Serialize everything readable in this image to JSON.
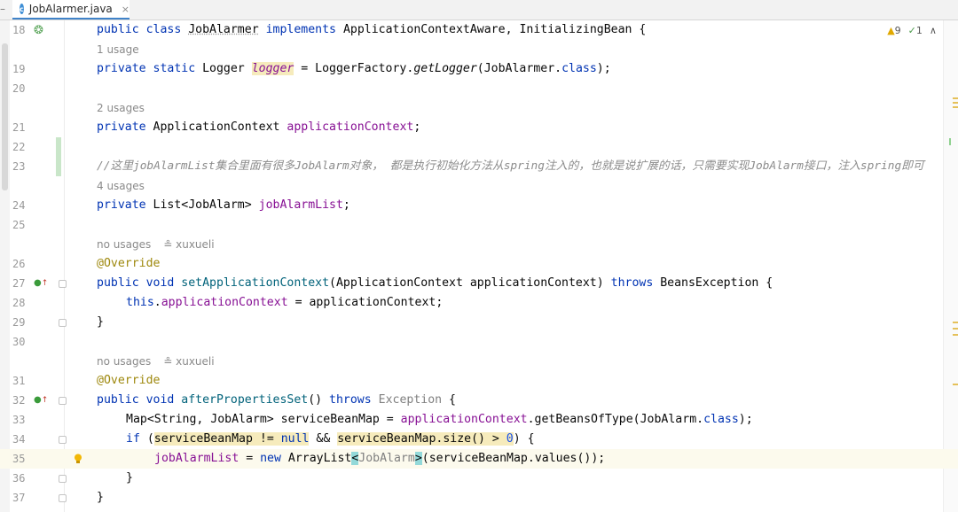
{
  "tab": {
    "file_name": "JobAlarmer.java",
    "icon": "java-class-icon",
    "close": "×"
  },
  "inspections": {
    "warnings": "9",
    "ok": "1",
    "up": "∧",
    "down": "∨"
  },
  "code": {
    "l18": {
      "num": "18",
      "kw1": "public class",
      "name": "JobAlarmer",
      "kw2": "implements",
      "rest": "ApplicationContextAware, InitializingBean {"
    },
    "l19_usage": "1 usage",
    "l19": {
      "num": "19",
      "kw": "private static",
      "type": "Logger",
      "field": "logger",
      "eq": " = LoggerFactory.",
      "method": "getLogger",
      "args1": "(JobAlarmer.",
      "cls": "class",
      "args2": ");"
    },
    "l20": {
      "num": "20"
    },
    "l21_usage": "2 usages",
    "l21": {
      "num": "21",
      "kw": "private",
      "type": "ApplicationContext",
      "field": "applicationContext",
      "end": ";"
    },
    "l22": {
      "num": "22"
    },
    "l23": {
      "num": "23",
      "comment": "//这里jobAlarmList集合里面有很多JobAlarm对象， 都是执行初始化方法从spring注入的，也就是说扩展的话，只需要实现JobAlarm接口，注入spring即可"
    },
    "l24_usage": "4 usages",
    "l24": {
      "num": "24",
      "kw": "private",
      "type": "List<JobAlarm>",
      "field": "jobAlarmList",
      "end": ";"
    },
    "l25": {
      "num": "25"
    },
    "l26_usage": "no usages",
    "l26_author": "xuxueli",
    "l26": {
      "num": "26",
      "ann": "@Override"
    },
    "l27": {
      "num": "27",
      "kw1": "public void",
      "method": "setApplicationContext",
      "args": "(ApplicationContext applicationContext) ",
      "kw2": "throws",
      "rest": " BeansException {"
    },
    "l28": {
      "num": "28",
      "kw": "this",
      "dot": ".",
      "field": "applicationContext",
      "rest": " = applicationContext;"
    },
    "l29": {
      "num": "29",
      "text": "}"
    },
    "l30": {
      "num": "30"
    },
    "l31_usage": "no usages",
    "l31_author": "xuxueli",
    "l31": {
      "num": "31",
      "ann": "@Override"
    },
    "l32": {
      "num": "32",
      "kw1": "public void",
      "method": "afterPropertiesSet",
      "args": "() ",
      "kw2": "throws",
      "exc": " Exception",
      "rest": " {"
    },
    "l33": {
      "num": "33",
      "type": "Map<String, JobAlarm> serviceBeanMap = ",
      "field": "applicationContext",
      "rest1": ".getBeansOfType(JobAlarm.",
      "cls": "class",
      "rest2": ");"
    },
    "l34": {
      "num": "34",
      "kw1": "if",
      "p1": " (",
      "h1": "serviceBeanMap != ",
      "kw2": "null",
      "mid": " && ",
      "h2": "serviceBeanMap.size() > ",
      "zero": "0",
      "rest": ") {"
    },
    "l35": {
      "num": "35",
      "field": "jobAlarmList",
      "eq": " = ",
      "kw": "new",
      "cls": " ArrayList",
      "lt": "<",
      "gen": "JobAlarm",
      "gt": ">",
      "rest": "(serviceBeanMap.values());"
    },
    "l36": {
      "num": "36",
      "text": "}"
    },
    "l37": {
      "num": "37",
      "text": "}"
    }
  },
  "colors": {
    "keyword": "#0033b3",
    "field": "#871094",
    "annotation": "#9e880d",
    "comment": "#8c8c8c",
    "highlight": "#f6ebbc",
    "bracket_match": "#93d9d9"
  }
}
